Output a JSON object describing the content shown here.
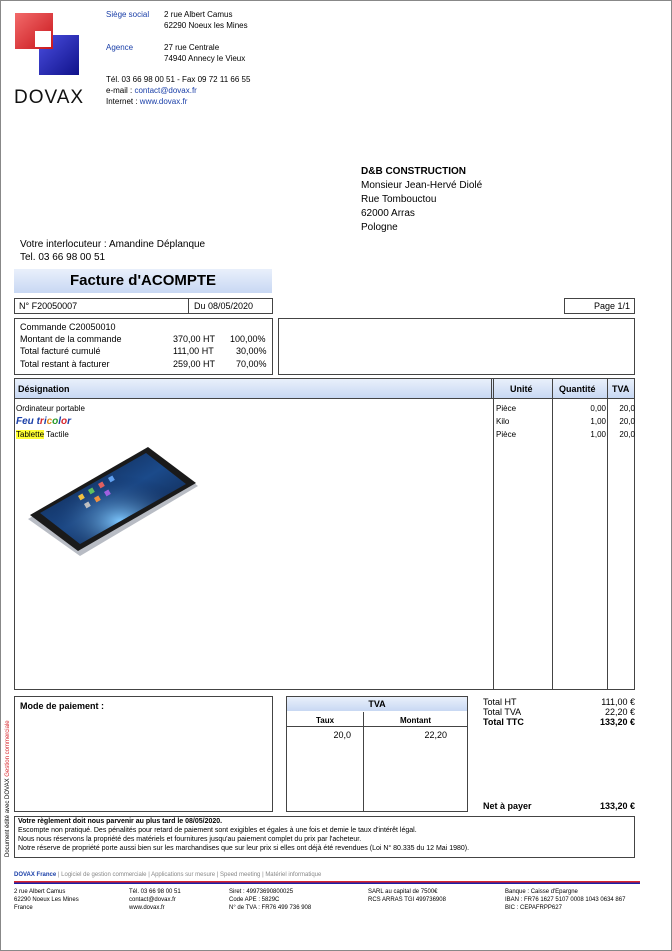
{
  "company": {
    "logo_text": "DOVAX",
    "siege_label": "Siège social",
    "siege_line1": "2 rue Albert Camus",
    "siege_line2": "62290 Noeux les Mines",
    "agence_label": "Agence",
    "agence_line1": "27 rue Centrale",
    "agence_line2": "74940 Annecy le Vieux",
    "tel_fax": "Tél. 03 66 98 00 51 - Fax 09 72 11 66 55",
    "email_label": "e-mail : ",
    "email": "contact@dovax.fr",
    "internet_label": "Internet : ",
    "website": "www.dovax.fr"
  },
  "recipient": {
    "company": "D&B CONSTRUCTION",
    "name": "Monsieur Jean-Hervé Diolé",
    "street": "Rue Tombouctou",
    "city": "62000 Arras",
    "country": "Pologne"
  },
  "contact": {
    "line1": "Votre interlocuteur : Amandine Déplanque",
    "line2": "Tel. 03 66 98 00 51"
  },
  "invoice": {
    "title": "Facture d'ACOMPTE",
    "number": "N° F20050007",
    "date": "Du 08/05/2020",
    "page": "Page 1/1"
  },
  "summary": {
    "order": "Commande C20050010",
    "rows": [
      {
        "label": "Montant de la commande",
        "amount": "370,00 HT",
        "pct": "100,00%"
      },
      {
        "label": "Total facturé cumulé",
        "amount": "111,00 HT",
        "pct": "30,00%"
      },
      {
        "label": "Total restant à facturer",
        "amount": "259,00 HT",
        "pct": "70,00%"
      }
    ]
  },
  "table": {
    "headers": {
      "designation": "Désignation",
      "unite": "Unité",
      "quantite": "Quantité",
      "tva": "TVA"
    },
    "items": [
      {
        "designation": "Ordinateur portable",
        "unite": "Pièce",
        "quantite": "0,00",
        "tva": "20,0"
      },
      {
        "designation": "Feu tricolor",
        "unite": "Kilo",
        "quantite": "1,00",
        "tva": "20,0"
      },
      {
        "designation_highlight": "Tablette",
        "designation_rest": " Tactile",
        "unite": "Pièce",
        "quantite": "1,00",
        "tva": "20,0"
      }
    ]
  },
  "payment": {
    "label": "Mode de paiement :",
    "tva_title": "TVA",
    "taux_label": "Taux",
    "montant_label": "Montant",
    "taux": "20,0",
    "montant": "22,20",
    "total_ht_label": "Total HT",
    "total_ht": "111,00 €",
    "total_tva_label": "Total TVA",
    "total_tva": "22,20 €",
    "total_ttc_label": "Total TTC",
    "total_ttc": "133,20 €",
    "net_label": "Net à payer",
    "net": "133,20 €"
  },
  "conditions": {
    "line1": "Votre règlement doit nous parvenir au plus tard le 08/05/2020.",
    "line2": "Escompte non pratiqué. Des pénalités pour retard de paiement sont exigibles et égales à une fois et demie le taux d'intérêt légal.",
    "line3": "Nous nous réservons la propriété des matériels et fournitures jusqu'au paiement complet du prix par l'acheteur.",
    "line4": "Notre réserve de propriété porte aussi bien sur les marchandises que sur leur prix si elles ont déjà été revendues (Loi N° 80.335 du 12 Mai 1980)."
  },
  "side_text": {
    "part1": "Document édité avec DOVAX ",
    "part2": "Gestion commerciale"
  },
  "footer": {
    "links": [
      "DOVAX France",
      "Logiciel de gestion commerciale",
      "Applications sur mesure",
      "Speed meeting",
      "Matériel informatique"
    ],
    "col1": [
      "2 rue Albert Camus",
      "62290 Noeux Les Mines",
      "France"
    ],
    "col2": [
      "Tél. 03 66 98 00 51",
      "contact@dovax.fr",
      "www.dovax.fr"
    ],
    "col3": [
      "Siret : 49973690800025",
      "Code APE : 5829C",
      "N° de TVA : FR76 499 736 908"
    ],
    "col4": [
      "SARL au capital de 7500€",
      "RCS ARRAS TGI 499736908"
    ],
    "col5": [
      "Banque : Caisse d'Epargne",
      "IBAN : FR76 1627 5107 0008 1043 0634 867",
      "BIC : CEPAFRPP627"
    ]
  },
  "colors": {
    "accent": "#1a3fa8",
    "logo_red": "#d8262c",
    "logo_blue": "#1b1ea8"
  }
}
